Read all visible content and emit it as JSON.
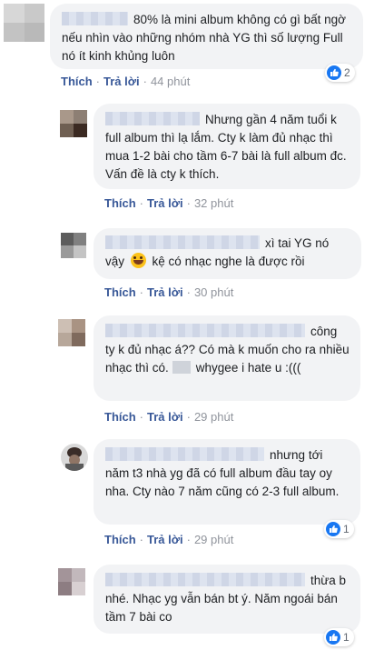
{
  "comments": [
    {
      "text": "80% là mini album không có gì bất ngờ nếu nhìn vào những nhóm nhà YG thì số lượng Full nó ít kinh khủng luôn",
      "like": "Thích",
      "reply": "Trả lời",
      "time": "44 phút",
      "reactions": "2"
    },
    {
      "text": "Nhưng gần 4 năm tuổi k full album thì lạ lắm. Cty k làm đủ nhạc thì mua 1-2 bài cho tầm 6-7 bài là full album đc. Vấn đề là cty k thích.",
      "like": "Thích",
      "reply": "Trả lời",
      "time": "32 phút"
    },
    {
      "text_a": "xì tai YG nó vậy",
      "text_b": "kệ có nhạc nghe là được rồi",
      "like": "Thích",
      "reply": "Trả lời",
      "time": "30 phút"
    },
    {
      "text_a": "công ty k đủ nhạc á?? Có mà k muốn cho ra nhiều nhạc thì có.",
      "text_b": "whygee i hate u :(((",
      "like": "Thích",
      "reply": "Trả lời",
      "time": "29 phút"
    },
    {
      "text": "nhưng tới năm t3 nhà yg đã có full album đầu tay oy nha. Cty nào 7 năm cũng có 2-3 full album.",
      "like": "Thích",
      "reply": "Trả lời",
      "time": "29 phút",
      "reactions": "1"
    },
    {
      "text": "thừa b nhé. Nhạc yg vẫn bán bt ý. Năm ngoái bán tầm 7 bài co",
      "reactions": "1"
    }
  ],
  "icons": {
    "reaction": "like-icon"
  },
  "colors": {
    "link": "#385898",
    "bubble": "#f2f3f5",
    "like": "#1877f2"
  }
}
